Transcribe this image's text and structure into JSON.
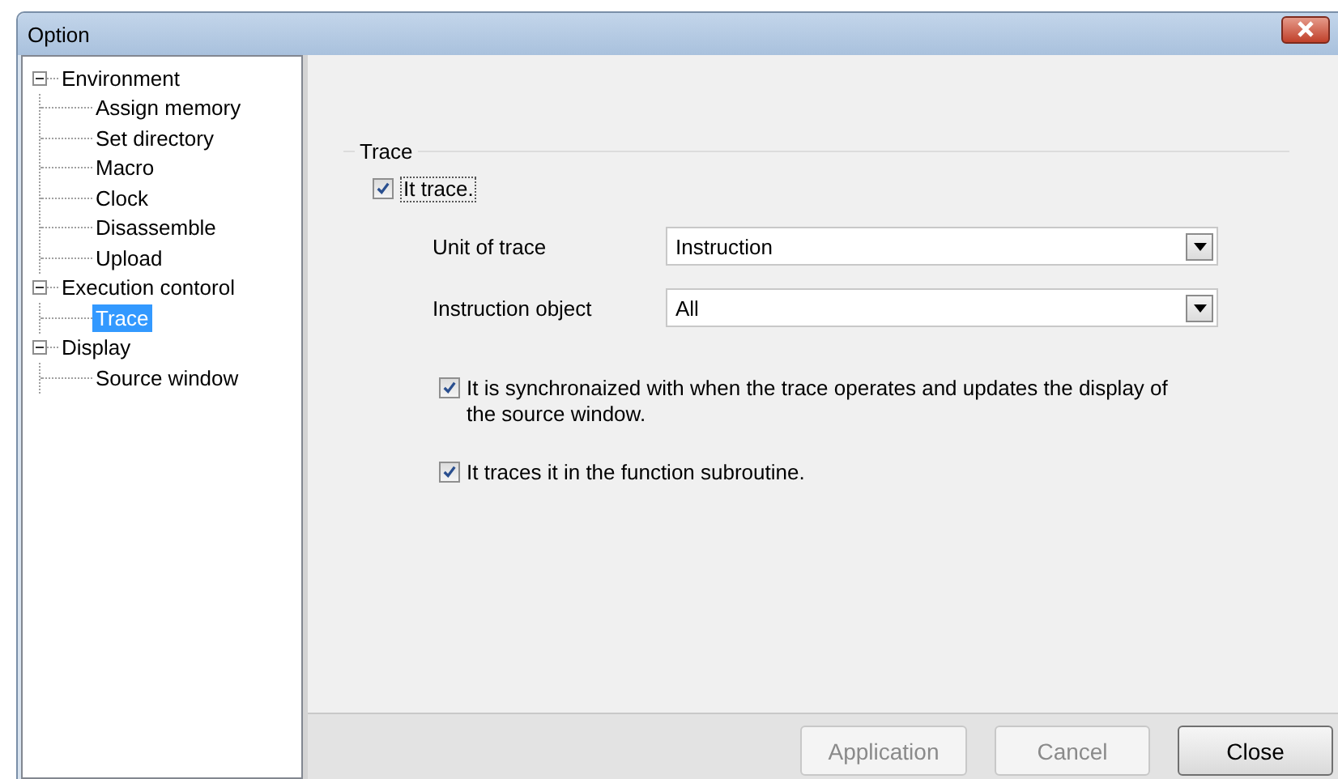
{
  "window": {
    "title": "Option"
  },
  "tree": [
    {
      "label": "Environment",
      "expanded": true,
      "selected": false,
      "children": [
        {
          "label": "Assign memory",
          "selected": false
        },
        {
          "label": "Set directory",
          "selected": false
        },
        {
          "label": "Macro",
          "selected": false
        },
        {
          "label": "Clock",
          "selected": false
        },
        {
          "label": "Disassemble",
          "selected": false
        },
        {
          "label": "Upload",
          "selected": false
        }
      ]
    },
    {
      "label": "Execution contorol",
      "expanded": true,
      "selected": false,
      "children": [
        {
          "label": "Trace",
          "selected": true
        }
      ]
    },
    {
      "label": "Display",
      "expanded": true,
      "selected": false,
      "children": [
        {
          "label": "Source window",
          "selected": false
        }
      ]
    }
  ],
  "group": {
    "title": "Trace",
    "enable": {
      "label": "It trace.",
      "checked": true,
      "focused": true
    },
    "fields": [
      {
        "label": "Unit of trace",
        "value": "Instruction"
      },
      {
        "label": "Instruction object",
        "value": "All"
      }
    ],
    "options": [
      {
        "label": "It is synchronaized with when the trace operates and updates the display of the source window.",
        "checked": true
      },
      {
        "label": "It traces it in the function subroutine.",
        "checked": true
      }
    ]
  },
  "buttons": [
    {
      "label": "Application",
      "disabled": true
    },
    {
      "label": "Cancel",
      "disabled": true
    },
    {
      "label": "Close",
      "disabled": false
    }
  ]
}
